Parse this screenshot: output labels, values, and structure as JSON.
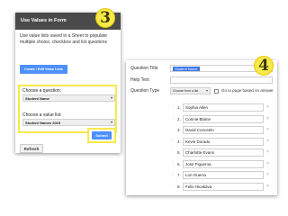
{
  "left_panel": {
    "header": "Use Values in Form",
    "description": "Use value lists saved in a Sheet to populate multiple choice, checkbox and list questions",
    "create_button": "Create / Edit Value Lists",
    "question_label": "Choose a question:",
    "question_value": "Student Name",
    "value_list_label": "Choose a value list:",
    "value_list_value": "Student Names 2015",
    "refresh_button": "Refresh",
    "submit_button": "Submit"
  },
  "badges": {
    "left": "3",
    "right": "4"
  },
  "right_panel": {
    "question_title_label": "Question Title",
    "question_title_value": "Student Name",
    "help_text_label": "Help Text",
    "question_type_label": "Question Type",
    "question_type_value": "Choose from a list",
    "go_to_page_label": "Go to page based on answer",
    "options": [
      {
        "num": "1.",
        "name": "Sophia Allen"
      },
      {
        "num": "2.",
        "name": "Connie Blaine"
      },
      {
        "num": "3.",
        "name": "David Conceelo"
      },
      {
        "num": "4.",
        "name": "Kevin Dorado"
      },
      {
        "num": "5.",
        "name": "Charlotte Evans"
      },
      {
        "num": "6.",
        "name": "Jose Figueroa"
      },
      {
        "num": "7.",
        "name": "Lori Guerra"
      },
      {
        "num": "8.",
        "name": "Felix Hicakava"
      }
    ]
  },
  "colors": {
    "accent": "#4d90fe",
    "highlight": "#f7e94a",
    "header_bg": "#4a4a4a"
  },
  "icons": {
    "dropdown": "chevron-down-icon",
    "remove": "close-icon",
    "drag": "drag-handle-icon"
  }
}
